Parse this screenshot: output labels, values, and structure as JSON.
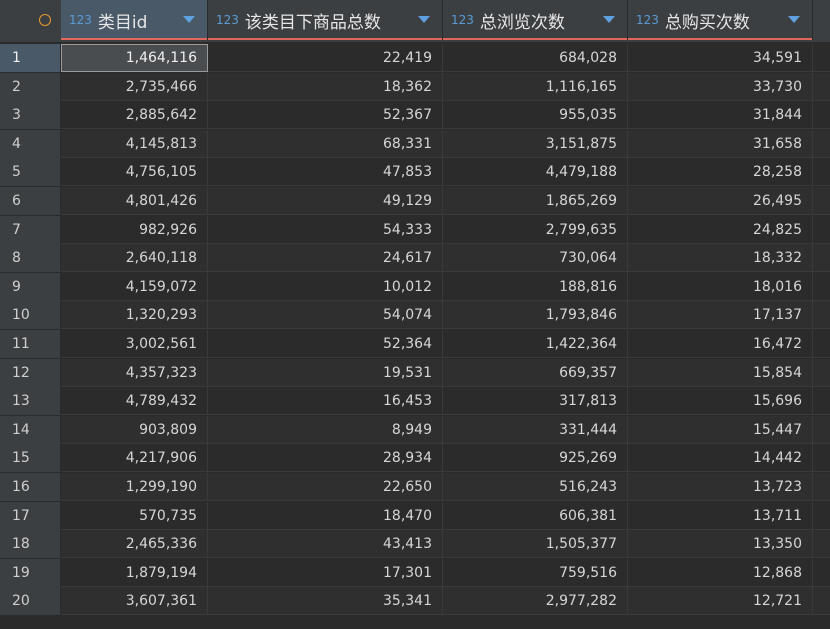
{
  "corner": {
    "icon": "circle-icon"
  },
  "columns": [
    {
      "type": "123",
      "label": "类目id"
    },
    {
      "type": "123",
      "label": "该类目下商品总数"
    },
    {
      "type": "123",
      "label": "总浏览次数"
    },
    {
      "type": "123",
      "label": "总购买次数"
    }
  ],
  "rows": [
    {
      "n": "1",
      "c": [
        "1,464,116",
        "22,419",
        "684,028",
        "34,591"
      ]
    },
    {
      "n": "2",
      "c": [
        "2,735,466",
        "18,362",
        "1,116,165",
        "33,730"
      ]
    },
    {
      "n": "3",
      "c": [
        "2,885,642",
        "52,367",
        "955,035",
        "31,844"
      ]
    },
    {
      "n": "4",
      "c": [
        "4,145,813",
        "68,331",
        "3,151,875",
        "31,658"
      ]
    },
    {
      "n": "5",
      "c": [
        "4,756,105",
        "47,853",
        "4,479,188",
        "28,258"
      ]
    },
    {
      "n": "6",
      "c": [
        "4,801,426",
        "49,129",
        "1,865,269",
        "26,495"
      ]
    },
    {
      "n": "7",
      "c": [
        "982,926",
        "54,333",
        "2,799,635",
        "24,825"
      ]
    },
    {
      "n": "8",
      "c": [
        "2,640,118",
        "24,617",
        "730,064",
        "18,332"
      ]
    },
    {
      "n": "9",
      "c": [
        "4,159,072",
        "10,012",
        "188,816",
        "18,016"
      ]
    },
    {
      "n": "10",
      "c": [
        "1,320,293",
        "54,074",
        "1,793,846",
        "17,137"
      ]
    },
    {
      "n": "11",
      "c": [
        "3,002,561",
        "52,364",
        "1,422,364",
        "16,472"
      ]
    },
    {
      "n": "12",
      "c": [
        "4,357,323",
        "19,531",
        "669,357",
        "15,854"
      ]
    },
    {
      "n": "13",
      "c": [
        "4,789,432",
        "16,453",
        "317,813",
        "15,696"
      ]
    },
    {
      "n": "14",
      "c": [
        "903,809",
        "8,949",
        "331,444",
        "15,447"
      ]
    },
    {
      "n": "15",
      "c": [
        "4,217,906",
        "28,934",
        "925,269",
        "14,442"
      ]
    },
    {
      "n": "16",
      "c": [
        "1,299,190",
        "22,650",
        "516,243",
        "13,723"
      ]
    },
    {
      "n": "17",
      "c": [
        "570,735",
        "18,470",
        "606,381",
        "13,711"
      ]
    },
    {
      "n": "18",
      "c": [
        "2,465,336",
        "43,413",
        "1,505,377",
        "13,350"
      ]
    },
    {
      "n": "19",
      "c": [
        "1,879,194",
        "17,301",
        "759,516",
        "12,868"
      ]
    },
    {
      "n": "20",
      "c": [
        "3,607,361",
        "35,341",
        "2,977,282",
        "12,721"
      ]
    }
  ]
}
